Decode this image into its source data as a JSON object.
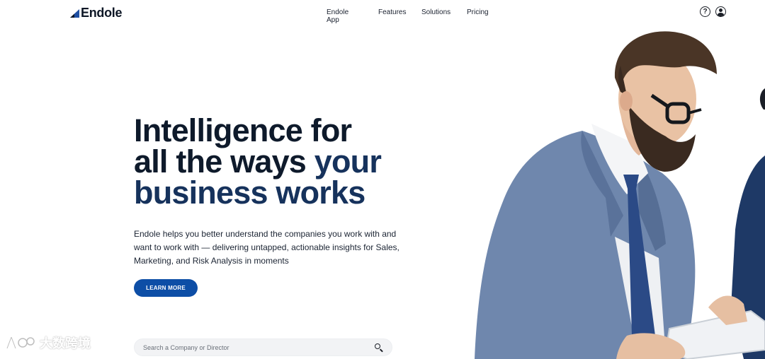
{
  "header": {
    "logo_text": "Endole",
    "nav": [
      {
        "label": "Endole App"
      },
      {
        "label": "Features"
      },
      {
        "label": "Solutions"
      },
      {
        "label": "Pricing"
      }
    ],
    "help_icon": "help-circle-icon",
    "account_icon": "user-circle-icon"
  },
  "hero": {
    "headline_line1": "Intelligence for",
    "headline_line2_part1": "all the ways",
    "headline_line2_part2": "your",
    "headline_line3": "business works",
    "subtext": "Endole helps you better understand the companies you work with and want to work with — delivering untapped, actionable insights for Sales, Marketing, and Risk Analysis in moments",
    "cta_label": "LEARN MORE"
  },
  "search": {
    "placeholder": "Search a Company or Director",
    "value": ""
  },
  "watermark": {
    "text": "大数跨境"
  },
  "colors": {
    "headline_dark": "#0e1a2b",
    "headline_accent": "#16325c",
    "cta": "#0d4ea6",
    "logo_mark": "#1f4fa3"
  }
}
